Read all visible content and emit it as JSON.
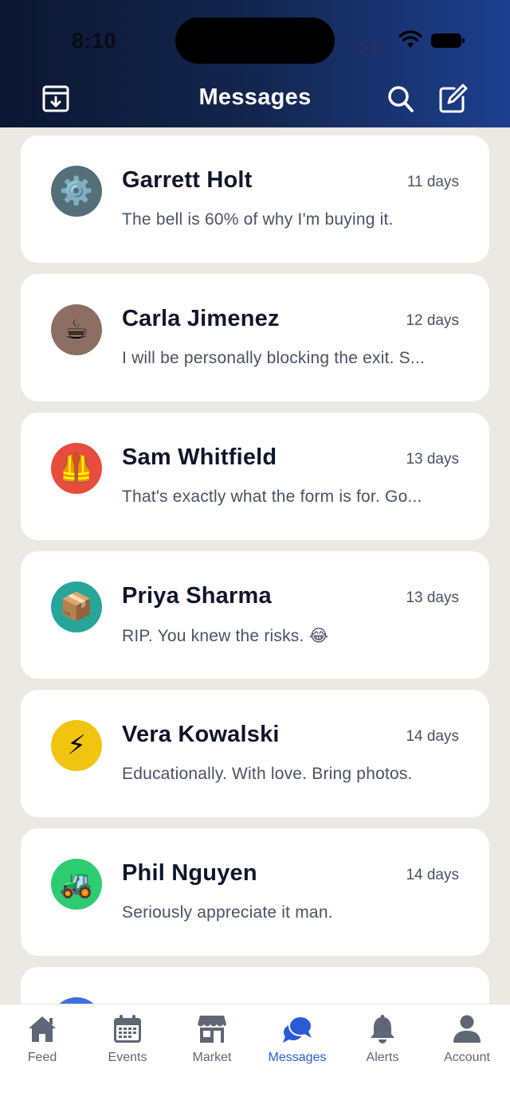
{
  "status_bar": {
    "time": "8:10"
  },
  "header": {
    "title": "Messages"
  },
  "conversations": [
    {
      "name": "Garrett Holt",
      "time": "11 days",
      "preview": "The bell is 60% of why I'm buying it.",
      "avatar_emoji": "⚙️",
      "avatar_color": "#546e7a"
    },
    {
      "name": "Carla Jimenez",
      "time": "12 days",
      "preview": "I will be personally blocking the exit. S...",
      "avatar_emoji": "☕",
      "avatar_color": "#8d6e63"
    },
    {
      "name": "Sam Whitfield",
      "time": "13 days",
      "preview": "That's exactly what the form is for. Go...",
      "avatar_emoji": "🦺",
      "avatar_color": "#e74c3c"
    },
    {
      "name": "Priya Sharma",
      "time": "13 days",
      "preview": "RIP. You knew the risks. 😂",
      "avatar_emoji": "📦",
      "avatar_color": "#26a69a"
    },
    {
      "name": "Vera Kowalski",
      "time": "14 days",
      "preview": "Educationally. With love. Bring photos.",
      "avatar_emoji": "⚡",
      "avatar_color": "#f1c40f"
    },
    {
      "name": "Phil Nguyen",
      "time": "14 days",
      "preview": "Seriously appreciate it man.",
      "avatar_emoji": "🚜",
      "avatar_color": "#2ecc71"
    },
    {
      "name": "",
      "time": "",
      "preview": "",
      "avatar_emoji": "",
      "avatar_color": "#3f6fe0"
    }
  ],
  "tabs": [
    {
      "label": "Feed",
      "icon": "home-icon"
    },
    {
      "label": "Events",
      "icon": "calendar-icon"
    },
    {
      "label": "Market",
      "icon": "store-icon"
    },
    {
      "label": "Messages",
      "icon": "chat-icon",
      "active": true
    },
    {
      "label": "Alerts",
      "icon": "bell-icon"
    },
    {
      "label": "Account",
      "icon": "person-icon"
    }
  ],
  "colors": {
    "accent": "#2a5bd7",
    "inactive": "#5f6675",
    "header_dark": "#0c1730",
    "header_light": "#1d3f8e"
  }
}
